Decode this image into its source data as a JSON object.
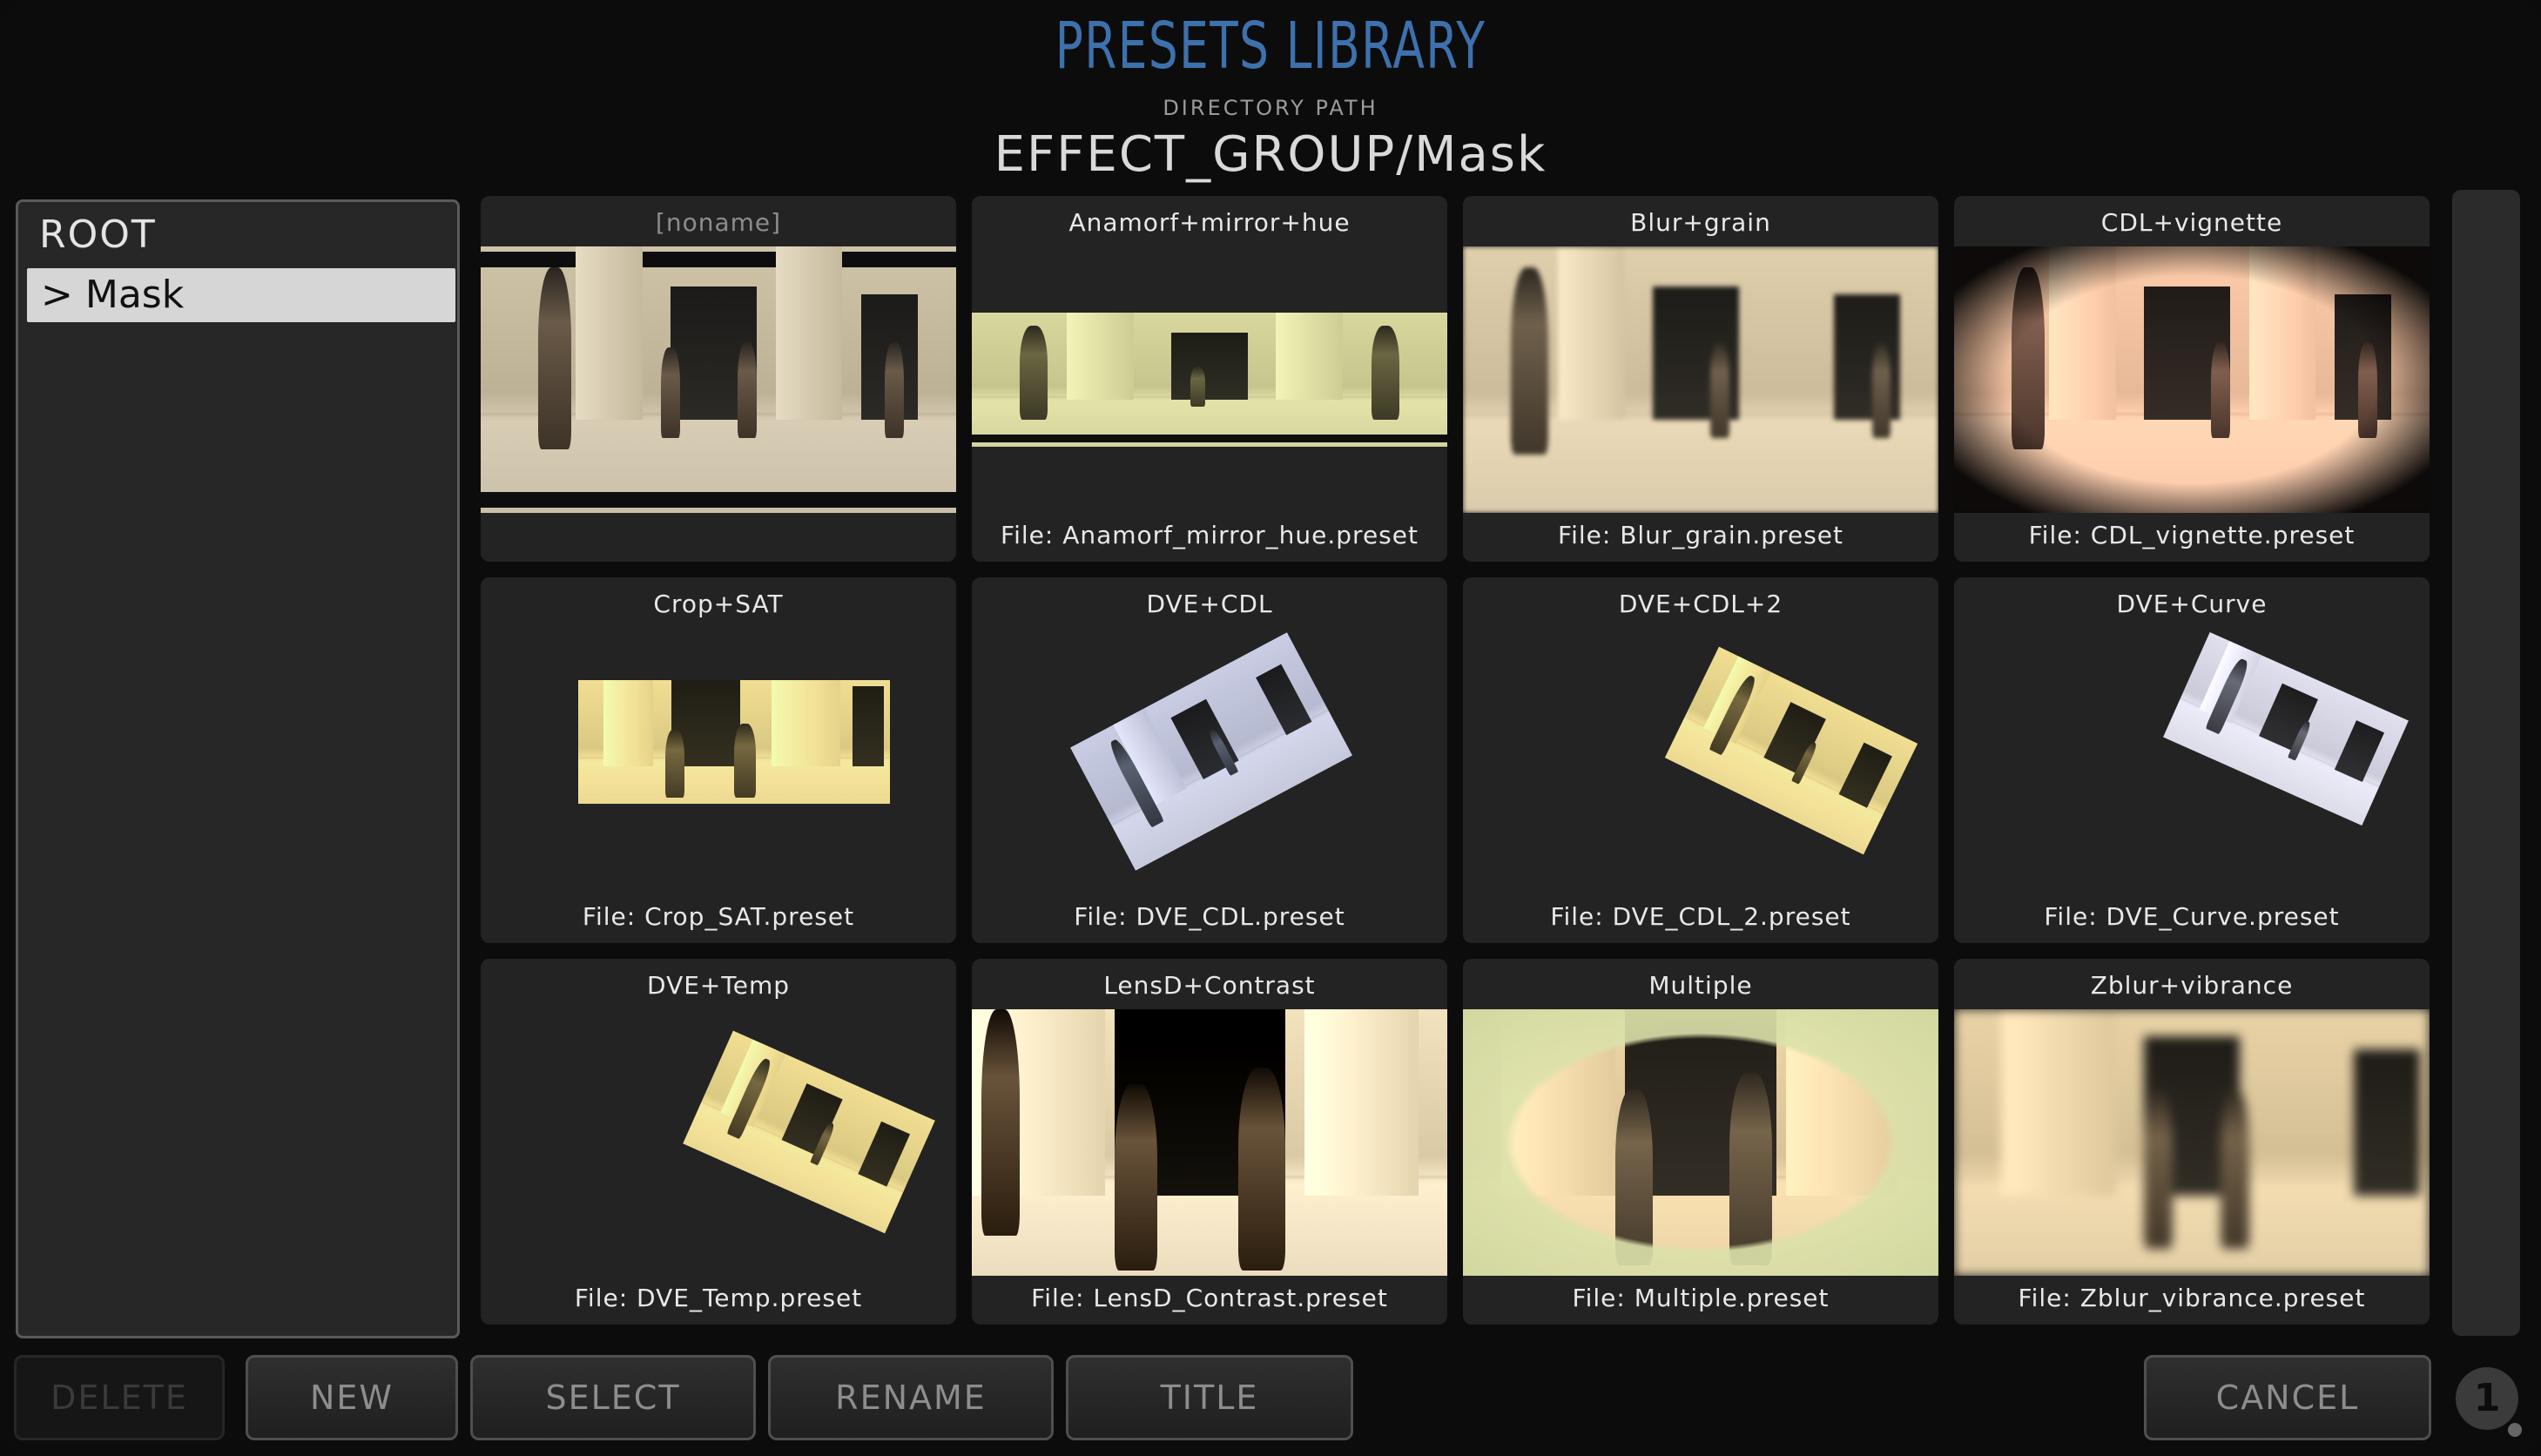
{
  "header": {
    "title": "PRESETS LIBRARY",
    "directory_label": "DIRECTORY PATH",
    "directory_path": "EFFECT_GROUP/Mask"
  },
  "tree": {
    "root_label": "ROOT",
    "selected_item": {
      "caret": ">",
      "label": "Mask"
    }
  },
  "presets": [
    {
      "name": "[noname]",
      "file": ""
    },
    {
      "name": "Anamorf+mirror+hue",
      "file": "File: Anamorf_mirror_hue.preset"
    },
    {
      "name": "Blur+grain",
      "file": "File: Blur_grain.preset"
    },
    {
      "name": "CDL+vignette",
      "file": "File: CDL_vignette.preset"
    },
    {
      "name": "Crop+SAT",
      "file": "File: Crop_SAT.preset"
    },
    {
      "name": "DVE+CDL",
      "file": "File: DVE_CDL.preset"
    },
    {
      "name": "DVE+CDL+2",
      "file": "File: DVE_CDL_2.preset"
    },
    {
      "name": "DVE+Curve",
      "file": "File: DVE_Curve.preset"
    },
    {
      "name": "DVE+Temp",
      "file": "File: DVE_Temp.preset"
    },
    {
      "name": "LensD+Contrast",
      "file": "File: LensD_Contrast.preset"
    },
    {
      "name": "Multiple",
      "file": "File: Multiple.preset"
    },
    {
      "name": "Zblur+vibrance",
      "file": "File: Zblur_vibrance.preset"
    }
  ],
  "buttons": {
    "delete": "DELETE",
    "new": "NEW",
    "select": "SELECT",
    "rename": "RENAME",
    "title": "TITLE",
    "cancel": "CANCEL"
  },
  "badge": {
    "value": "1"
  },
  "colors": {
    "title": "#3d71ad",
    "background": "#0c0c0c",
    "tile": "#232323",
    "selected_item": "#d6d6d6"
  }
}
